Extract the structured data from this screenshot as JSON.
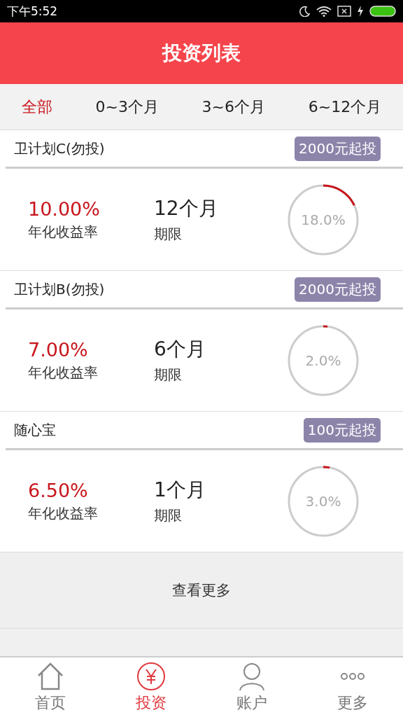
{
  "status_bar": {
    "time": "下午5:52"
  },
  "header": {
    "title": "投资列表"
  },
  "tabs": [
    {
      "label": "全部",
      "selected": true
    },
    {
      "label": "0~3个月",
      "selected": false
    },
    {
      "label": "3~6个月",
      "selected": false
    },
    {
      "label": "6~12个月",
      "selected": false
    }
  ],
  "products": [
    {
      "name": "卫计划C(勿投)",
      "min_badge": "2000元起投",
      "rate": "10.00%",
      "rate_label": "年化收益率",
      "term": "12个月",
      "term_label": "期限",
      "progress": "18.0%",
      "level": 0.18
    },
    {
      "name": "卫计划B(勿投)",
      "min_badge": "2000元起投",
      "rate": "7.00%",
      "rate_label": "年化收益率",
      "term": "6个月",
      "term_label": "期限",
      "progress": "2.0%",
      "level": 0.02
    },
    {
      "name": "随心宝",
      "min_badge": "100元起投",
      "rate": "6.50%",
      "rate_label": "年化收益率",
      "term": "1个月",
      "term_label": "期限",
      "progress": "3.0%",
      "level": 0.03
    }
  ],
  "more_button": "查看更多",
  "nav": [
    {
      "kind": "home",
      "label": "首页",
      "selected": false
    },
    {
      "kind": "invest",
      "label": "投资",
      "selected": true
    },
    {
      "kind": "account",
      "label": "账户",
      "selected": false
    },
    {
      "kind": "more",
      "label": "更多",
      "selected": false
    }
  ]
}
